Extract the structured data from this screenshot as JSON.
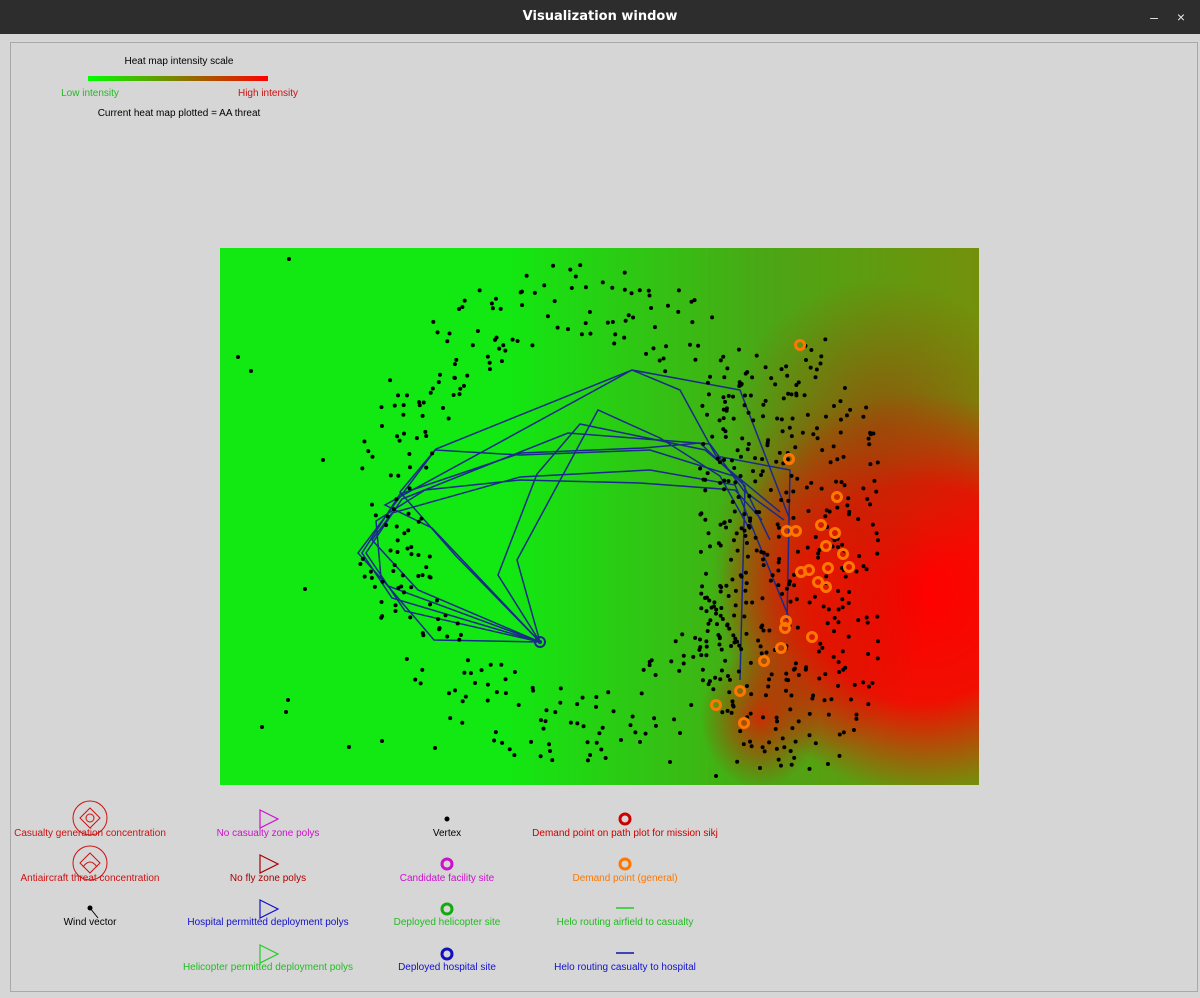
{
  "window": {
    "title": "Visualization window",
    "minimize_label": "–",
    "close_label": "×"
  },
  "scale": {
    "title": "Heat map intensity scale",
    "low_label": "Low intensity",
    "high_label": "High intensity",
    "low_color": "#00ff00",
    "high_color": "#ff0000",
    "current_label": "Current heat map plotted = AA threat"
  },
  "legend": {
    "casualty_concentration": "Casualty generation concentration",
    "aa_concentration": "Antiaircraft threat concentration",
    "wind_vector": "Wind vector",
    "no_casualty_zone": "No casualty zone polys",
    "no_fly_zone": "No fly zone polys",
    "hospital_deploy": "Hospital permitted deployment polys",
    "helicopter_deploy": "Helicopter permitted deployment polys",
    "vertex": "Vertex",
    "candidate_site": "Candidate facility site",
    "deployed_heli": "Deployed helicopter site",
    "deployed_hospital": "Deployed hospital site",
    "demand_mission": "Demand point on path plot for mission sikj",
    "demand_general": "Demand point (general)",
    "helo_airfield": "Helo routing airfield to casualty",
    "helo_hospital": "Helo routing casualty to hospital"
  },
  "colors": {
    "casualty": "#cc1111",
    "aa": "#cc1111",
    "no_casualty": "#cc11cc",
    "no_fly": "#aa0000",
    "hospital": "#1111cc",
    "helicopter": "#22cc22",
    "demand_mission": "#cc0000",
    "demand_general": "#ff7700",
    "route": "#1a2a8a",
    "vertex": "#000000"
  },
  "map": {
    "hospital": [
      540,
      642
    ],
    "demand_points": [
      [
        800,
        345
      ],
      [
        789,
        459
      ],
      [
        837,
        497
      ],
      [
        821,
        525
      ],
      [
        787,
        531
      ],
      [
        796,
        531
      ],
      [
        835,
        533
      ],
      [
        843,
        554
      ],
      [
        826,
        546
      ],
      [
        849,
        567
      ],
      [
        828,
        568
      ],
      [
        809,
        570
      ],
      [
        801,
        572
      ],
      [
        818,
        582
      ],
      [
        826,
        587
      ],
      [
        786,
        621
      ],
      [
        785,
        628
      ],
      [
        812,
        637
      ],
      [
        781,
        648
      ],
      [
        764,
        661
      ],
      [
        740,
        691
      ],
      [
        716,
        705
      ],
      [
        744,
        723
      ]
    ],
    "routes": [
      [
        [
          540,
          642
        ],
        [
          392,
          598
        ],
        [
          362,
          553
        ],
        [
          400,
          494
        ],
        [
          521,
          453
        ],
        [
          643,
          448
        ],
        [
          700,
          443
        ],
        [
          745,
          486
        ],
        [
          740,
          680
        ]
      ],
      [
        [
          540,
          642
        ],
        [
          388,
          586
        ],
        [
          358,
          553
        ],
        [
          436,
          449
        ],
        [
          632,
          370
        ],
        [
          680,
          390
        ],
        [
          716,
          456
        ],
        [
          790,
          470
        ],
        [
          787,
          620
        ]
      ],
      [
        [
          540,
          642
        ],
        [
          405,
          611
        ],
        [
          366,
          553
        ],
        [
          402,
          499
        ],
        [
          568,
          433
        ],
        [
          710,
          444
        ],
        [
          744,
          491
        ],
        [
          784,
          520
        ]
      ],
      [
        [
          540,
          642
        ],
        [
          434,
          640
        ],
        [
          381,
          578
        ],
        [
          376,
          521
        ],
        [
          425,
          490
        ],
        [
          520,
          480
        ],
        [
          640,
          483
        ],
        [
          735,
          490
        ],
        [
          762,
          520
        ]
      ],
      [
        [
          540,
          642
        ],
        [
          498,
          575
        ],
        [
          537,
          474
        ],
        [
          580,
          424
        ],
        [
          705,
          450
        ],
        [
          780,
          512
        ]
      ],
      [
        [
          540,
          642
        ],
        [
          517,
          560
        ],
        [
          598,
          410
        ],
        [
          660,
          438
        ],
        [
          720,
          476
        ],
        [
          750,
          530
        ]
      ],
      [
        [
          540,
          642
        ],
        [
          455,
          555
        ],
        [
          400,
          492
        ],
        [
          435,
          450
        ],
        [
          520,
          455
        ],
        [
          650,
          450
        ],
        [
          740,
          478
        ],
        [
          770,
          540
        ]
      ],
      [
        [
          540,
          642
        ],
        [
          418,
          590
        ],
        [
          372,
          540
        ],
        [
          392,
          513
        ],
        [
          520,
          477
        ],
        [
          650,
          470
        ],
        [
          735,
          485
        ],
        [
          790,
          620
        ]
      ],
      [
        [
          540,
          642
        ],
        [
          432,
          528
        ],
        [
          385,
          505
        ],
        [
          632,
          370
        ],
        [
          740,
          390
        ],
        [
          790,
          520
        ]
      ]
    ]
  }
}
